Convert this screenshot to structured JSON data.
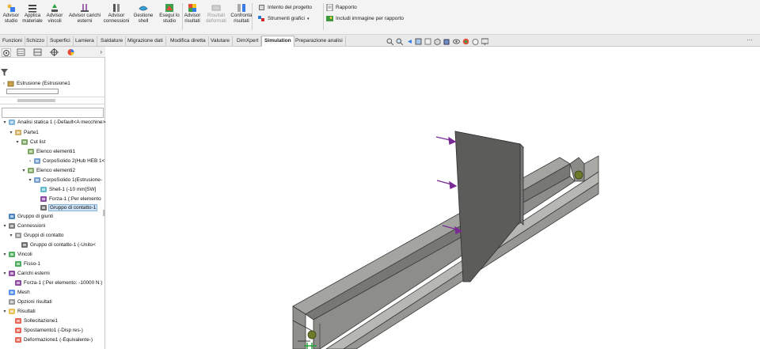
{
  "ribbon": {
    "buttons": [
      {
        "label": "Advisor\nstudio",
        "icon": "advisor-study-icon",
        "enabled": true
      },
      {
        "label": "Applica\nmateriale",
        "icon": "apply-material-icon",
        "enabled": true
      },
      {
        "label": "Advisor\nvincoli",
        "icon": "fixtures-advisor-icon",
        "enabled": true
      },
      {
        "label": "Advisor carichi\nesterni",
        "icon": "external-loads-icon",
        "enabled": true
      },
      {
        "label": "Advisor\nconnessioni",
        "icon": "connections-advisor-icon",
        "enabled": true
      },
      {
        "label": "Gestione\nshell",
        "icon": "shell-manager-icon",
        "enabled": true
      },
      {
        "label": "Esegui lo\nstudio",
        "icon": "run-study-icon",
        "enabled": true
      },
      {
        "label": "Advisor\nrisultati",
        "icon": "results-advisor-icon",
        "enabled": true
      },
      {
        "label": "Risultati\ndeformati",
        "icon": "deformed-results-icon",
        "enabled": false
      },
      {
        "label": "Confronta\nrisultati",
        "icon": "compare-results-icon",
        "enabled": true
      }
    ],
    "small_commands": [
      {
        "label": "Intento del progetto",
        "icon": "design-intent-icon"
      },
      {
        "label": "Strumenti grafici",
        "icon": "plot-tools-icon"
      },
      {
        "label": "Rapporto",
        "icon": "report-icon"
      },
      {
        "label": "Includi immagine per rapporto",
        "icon": "include-image-icon"
      }
    ]
  },
  "tabs": [
    "Funzioni",
    "Schizzo",
    "Superfici",
    "Lamiera",
    "Saldature",
    "Migrazione dati",
    "Modifica diretta",
    "Valutare",
    "DimXpert",
    "Simulation",
    "Preparazione analisi"
  ],
  "active_tab": "Simulation",
  "feature_panel": {
    "filter_icon": "filter-icon",
    "breadcrumb": "Estrusione (Estrusione1"
  },
  "tree": [
    {
      "label": "Analisi statica 1 (-Default<A mecchine>-)",
      "icon": "static-study-icon"
    },
    {
      "label": "Parte1",
      "icon": "part-icon"
    },
    {
      "label": "Cut list",
      "icon": "cut-list-icon"
    },
    {
      "label": "Elenco elementi1",
      "icon": "cut-list-item-icon"
    },
    {
      "label": "CorpoSolido 2(Hub HEB 1<",
      "icon": "solid-body-icon"
    },
    {
      "label": "Elenco elementi2",
      "icon": "cut-list-item-icon"
    },
    {
      "label": "CorpoSolido 1(Estrusione-",
      "icon": "solid-body-icon"
    },
    {
      "label": "Shell-1 (-10 mm[SW]",
      "icon": "shell-icon"
    },
    {
      "label": "Forza-1 (:Per elemento",
      "icon": "force-icon"
    },
    {
      "label": "Gruppo di contatto-1",
      "icon": "contact-set-icon"
    },
    {
      "label": "Gruppo di giunti",
      "icon": "joint-group-icon"
    },
    {
      "label": "Connessioni",
      "icon": "connections-icon"
    },
    {
      "label": "Gruppi di contatto",
      "icon": "contact-sets-icon"
    },
    {
      "label": "Gruppo di contatto-1 (-Unito<",
      "icon": "contact-set-icon"
    },
    {
      "label": "Vincoli",
      "icon": "fixtures-icon"
    },
    {
      "label": "Fisso-1",
      "icon": "fixed-icon"
    },
    {
      "label": "Carichi esterni",
      "icon": "external-loads-icon"
    },
    {
      "label": "Forza-1 (:Per elemento: -10000 N:)",
      "icon": "force-icon"
    },
    {
      "label": "Mesh",
      "icon": "mesh-icon"
    },
    {
      "label": "Opzioni risultati",
      "icon": "result-options-icon"
    },
    {
      "label": "Risultati",
      "icon": "results-icon"
    },
    {
      "label": "Sollecitazione1",
      "icon": "stress-plot-icon"
    },
    {
      "label": "Spostamento1 (-Disp res-)",
      "icon": "displacement-plot-icon"
    },
    {
      "label": "Deformazione1 (-Equivalente-)",
      "icon": "strain-plot-icon"
    }
  ],
  "colors": {
    "part_gray": "#8c8c88",
    "plate_dark": "#4f4f4f",
    "force_arrow": "#7a2b94",
    "fixture_green": "#2aa02a",
    "selection": "#cfe3f7"
  }
}
